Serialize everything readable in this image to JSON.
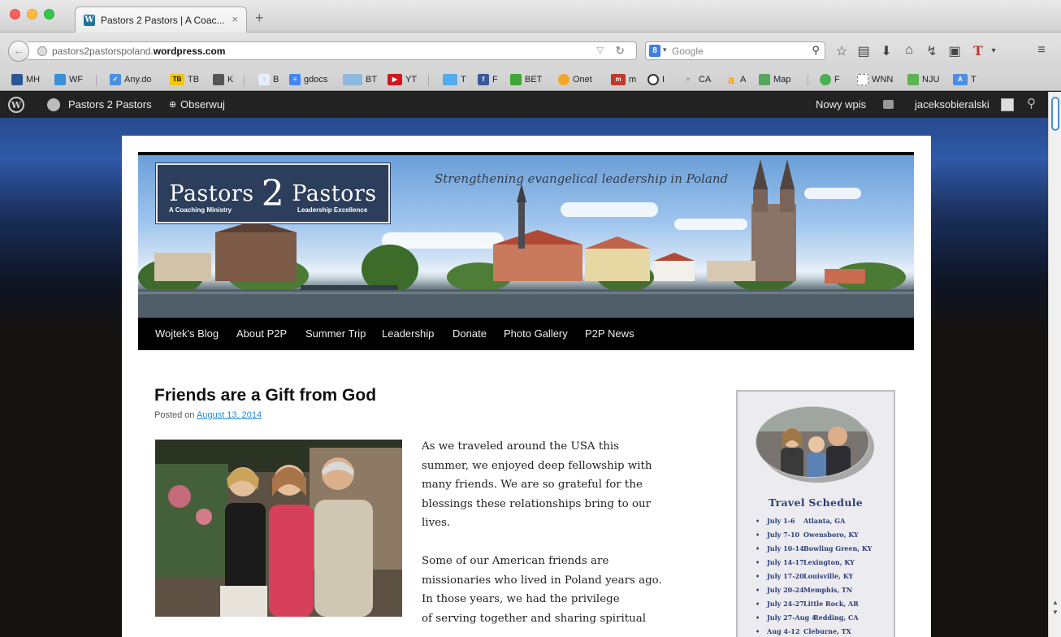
{
  "browser": {
    "tab_title": "Pastors 2 Pastors | A Coac...",
    "tab_close": "×",
    "new_tab": "+",
    "url_prefix": "pastors2pastorspoland.",
    "url_domain": "wordpress.com",
    "search_placeholder": "Google",
    "search_engine_badge": "8",
    "toolbar_icons": [
      "star-icon",
      "reading-list-icon",
      "download-icon",
      "home-icon",
      "sync-icon",
      "screenshot-icon",
      "t-extension-icon",
      "menu-icon"
    ],
    "bookmarks": [
      {
        "label": "MH",
        "color": "#2b5797"
      },
      {
        "label": "WF",
        "color": "#3a8fd8"
      },
      {
        "label": "Any.do",
        "color": "#4a90e2"
      },
      {
        "label": "TB",
        "icon_text": "TB",
        "color": "#f6c700"
      },
      {
        "label": "K",
        "color": "#555555"
      },
      {
        "label": "B",
        "color": "#6fa8dc"
      },
      {
        "label": "gdocs",
        "color": "#4285f4"
      },
      {
        "label": "BT",
        "color": "#8fb8de"
      },
      {
        "label": "YT",
        "color": "#cc181e"
      },
      {
        "label": "T",
        "color": "#55acee"
      },
      {
        "label": "F",
        "color": "#3b5998"
      },
      {
        "label": "BET",
        "color": "#3fa535"
      },
      {
        "label": "Onet",
        "color": "#f5a623"
      },
      {
        "label": "m",
        "color": "#c0392b"
      },
      {
        "label": "I",
        "color": "#333333"
      },
      {
        "label": "CA",
        "color": "#5aa04c"
      },
      {
        "label": "A",
        "color": "#ff9900"
      },
      {
        "label": "Map",
        "color": "#58a55c"
      },
      {
        "label": "F",
        "color": "#4caf50"
      },
      {
        "label": "WNN",
        "color": "#ffffff"
      },
      {
        "label": "NJU",
        "color": "#5ab552"
      },
      {
        "label": "T",
        "color": "#4a8fe2"
      }
    ]
  },
  "adminbar": {
    "site_name": "Pastors 2 Pastors",
    "follow": "Obserwuj",
    "new_post": "Nowy wpis",
    "username": "jaceksobieralski"
  },
  "header": {
    "logo_left": "Pastors",
    "logo_num": "2",
    "logo_right": "Pastors",
    "logo_sub_left": "A Coaching Ministry",
    "logo_sub_right": "Leadership Excellence",
    "tagline": "Strengthening evangelical leadership in Poland"
  },
  "nav": [
    "Wojtek's Blog",
    "About P2P",
    "Summer Trip",
    "Leadership",
    "Donate",
    "Photo Gallery",
    "P2P News"
  ],
  "post": {
    "title": "Friends are a Gift from God",
    "meta_prefix": "Posted on ",
    "date": "August 13, 2014",
    "paragraph1": [
      "As we traveled around the USA this",
      "summer, we enjoyed deep fellowship with",
      "many friends.   We are so grateful for the",
      "blessings these relationships bring to our",
      "lives."
    ],
    "paragraph2": [
      "Some of our American friends are",
      "missionaries who lived in Poland years ago.",
      "In those years, we had the privilege",
      "of serving together and sharing spiritual"
    ]
  },
  "sidebar": {
    "title": "Travel Schedule",
    "schedule": [
      {
        "dates": "July 1-6",
        "place": "Atlanta, GA"
      },
      {
        "dates": "July 7-10",
        "place": "Owensboro, KY"
      },
      {
        "dates": "July 10-14",
        "place": "Bowling Green, KY"
      },
      {
        "dates": "July 14-17",
        "place": "Lexington, KY"
      },
      {
        "dates": "July 17-20",
        "place": "Louisville, KY"
      },
      {
        "dates": "July 20-24",
        "place": "Memphis, TN"
      },
      {
        "dates": "July 24-27",
        "place": "Little Rock, AR"
      },
      {
        "dates": "July 27-Aug 4",
        "place": "Redding, CA"
      },
      {
        "dates": "Aug 4-12",
        "place": "Cleburne, TX"
      }
    ]
  }
}
